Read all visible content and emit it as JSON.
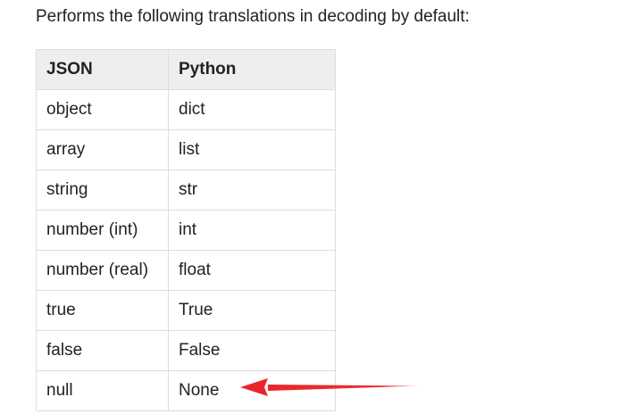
{
  "intro_text": "Performs the following translations in decoding by default:",
  "table": {
    "headers": [
      "JSON",
      "Python"
    ],
    "rows": [
      [
        "object",
        "dict"
      ],
      [
        "array",
        "list"
      ],
      [
        "string",
        "str"
      ],
      [
        "number (int)",
        "int"
      ],
      [
        "number (real)",
        "float"
      ],
      [
        "true",
        "True"
      ],
      [
        "false",
        "False"
      ],
      [
        "null",
        "None"
      ]
    ]
  },
  "annotation": {
    "type": "arrow",
    "color": "#e8262a",
    "points_to": "None"
  }
}
